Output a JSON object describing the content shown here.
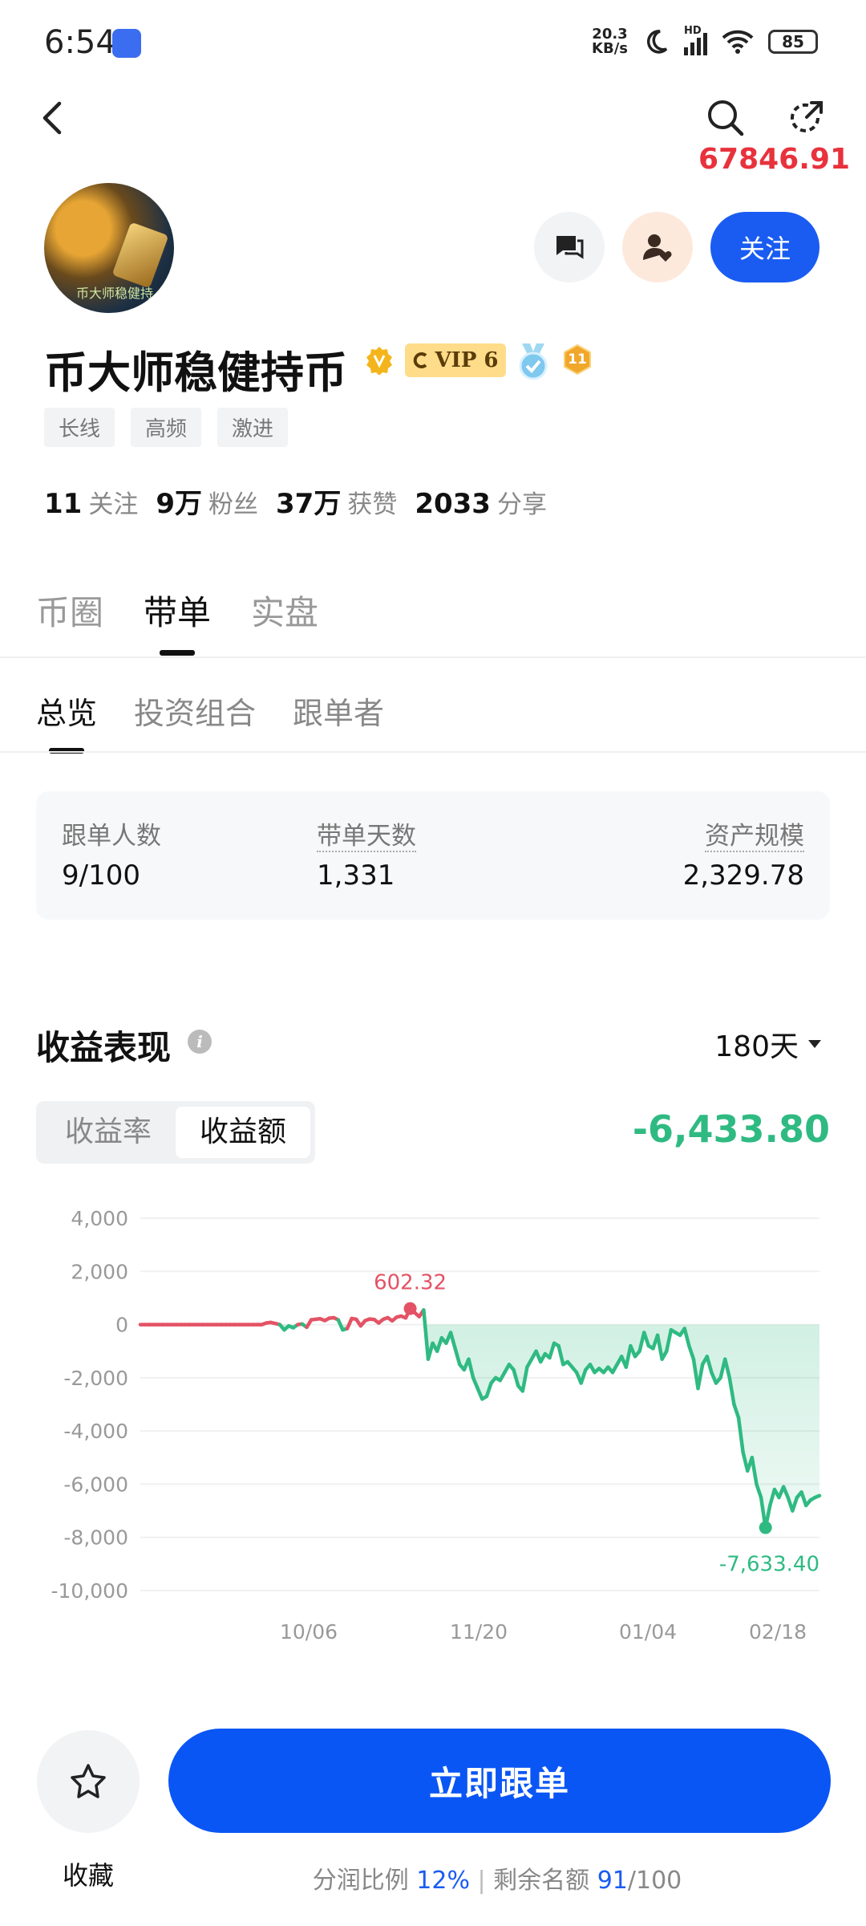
{
  "status_bar": {
    "time": "6:54",
    "net_speed_value": "20.3",
    "net_speed_unit": "KB/s",
    "network": "HD",
    "battery": "85"
  },
  "header": {
    "balance": "67846.91",
    "colors": {
      "accent": "#1a5cf2",
      "profit": "#e8323c",
      "loss": "#2fba82"
    }
  },
  "profile": {
    "avatar_text": "币大师稳健持",
    "name": "币大师稳健持币",
    "vip_label": "VIP 6",
    "level_badge": "11",
    "tags": [
      "长线",
      "高频",
      "激进"
    ],
    "stats": [
      {
        "value": "11",
        "label": "关注"
      },
      {
        "value": "9万",
        "label": "粉丝"
      },
      {
        "value": "37万",
        "label": "获赞"
      },
      {
        "value": "2033",
        "label": "分享"
      }
    ],
    "follow_label": "关注"
  },
  "tabs": {
    "primary": [
      "币圈",
      "带单",
      "实盘"
    ],
    "secondary": [
      "总览",
      "投资组合",
      "跟单者"
    ]
  },
  "summary": {
    "followers_label": "跟单人数",
    "followers_value": "9/100",
    "days_label": "带单天数",
    "days_value": "1,331",
    "aum_label": "资产规模",
    "aum_value": "2,329.78"
  },
  "performance": {
    "title": "收益表现",
    "period": "180天",
    "segment_rate": "收益率",
    "segment_amount": "收益额",
    "total": "-6,433.80"
  },
  "chart_data": {
    "type": "area",
    "yticks": [
      "4,000",
      "2,000",
      "0",
      "-2,000",
      "-4,000",
      "-6,000",
      "-8,000",
      "-10,000"
    ],
    "xticks": [
      "10/06",
      "11/20",
      "01/04",
      "02/18"
    ],
    "ylim": [
      -10000,
      4000
    ],
    "max_label": "602.32",
    "min_label": "-7,633.40",
    "series": [
      {
        "values": [
          0,
          0,
          0,
          0,
          0,
          0,
          0,
          0,
          0,
          0,
          0,
          0,
          0,
          0,
          0,
          0,
          0,
          0,
          0,
          0,
          0,
          0,
          0,
          0,
          0,
          0,
          0,
          0,
          60,
          80,
          40,
          0,
          -200,
          -50,
          -120,
          0,
          20,
          -100,
          180,
          200,
          220,
          150,
          240,
          260,
          180,
          -200,
          -150,
          230,
          200,
          -50,
          150,
          210,
          190,
          60,
          200,
          260,
          140,
          280,
          320,
          250,
          602,
          450,
          300,
          550,
          -1300,
          -700,
          -1000,
          -500,
          -700,
          -300,
          -900,
          -1500,
          -1700,
          -1300,
          -2000,
          -2400,
          -2800,
          -2700,
          -2200,
          -2000,
          -2100,
          -1800,
          -1500,
          -1700,
          -2300,
          -2500,
          -1600,
          -1300,
          -1000,
          -1400,
          -1100,
          -1250,
          -700,
          -800,
          -1500,
          -1400,
          -1600,
          -1800,
          -2200,
          -1700,
          -1500,
          -1800,
          -1650,
          -1800,
          -1600,
          -1800,
          -1500,
          -1200,
          -1600,
          -800,
          -1200,
          -1000,
          -300,
          -800,
          -900,
          -400,
          -1300,
          -1000,
          -200,
          -300,
          -400,
          -150,
          -800,
          -1300,
          -2400,
          -1500,
          -1200,
          -1800,
          -2200,
          -2000,
          -1300,
          -2000,
          -3000,
          -3500,
          -4800,
          -5500,
          -5000,
          -6000,
          -6500,
          -7633,
          -6800,
          -6200,
          -6500,
          -6100,
          -6500,
          -7000,
          -6500,
          -6300,
          -6800,
          -6600,
          -6500,
          -6433
        ],
        "color_positive": "#e35365",
        "color_negative": "#2fba82"
      }
    ]
  },
  "footer": {
    "favorite_label": "收藏",
    "cta_label": "立即跟单",
    "profit_share_label": "分润比例",
    "profit_share_value": "12%",
    "slots_label": "剩余名额",
    "slots_value": "91",
    "slots_total": "/100"
  }
}
